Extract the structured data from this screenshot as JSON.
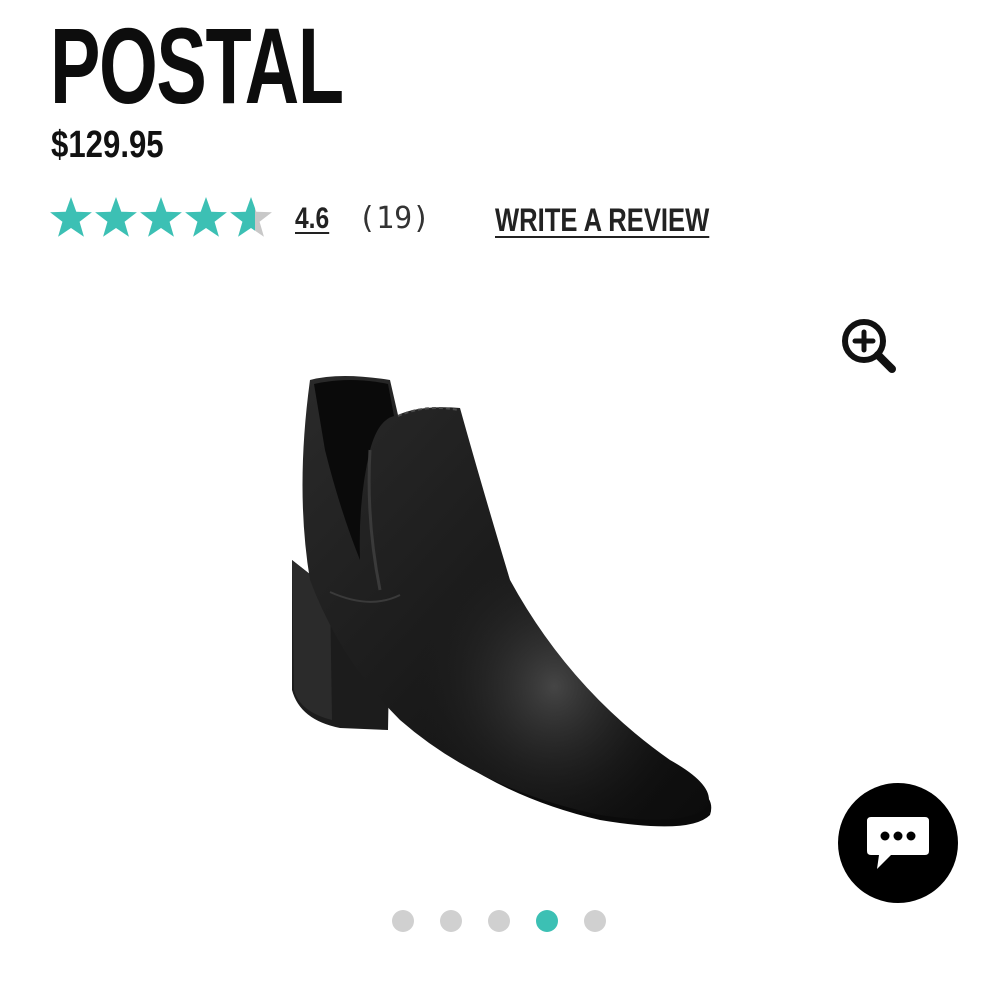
{
  "product": {
    "name": "POSTAL",
    "price": "$129.95"
  },
  "rating": {
    "value": "4.6",
    "score": 4.6,
    "max": 5,
    "count": "(19)",
    "star_color": "#3cc0b4",
    "empty_star_color": "#c8c8c8"
  },
  "actions": {
    "write_review": "WRITE A REVIEW",
    "zoom_icon": "zoom-in-icon",
    "chat_icon": "chat-bubble-icon"
  },
  "carousel": {
    "total": 5,
    "active_index": 3,
    "active_color": "#3cc0b4",
    "inactive_color": "#d0d0d0"
  }
}
